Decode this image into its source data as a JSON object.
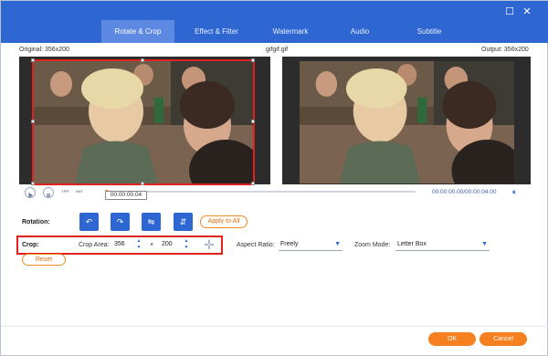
{
  "tabs": [
    {
      "label": "Rotate & Crop",
      "active": true
    },
    {
      "label": "Effect & Filter",
      "active": false
    },
    {
      "label": "Watermark",
      "active": false
    },
    {
      "label": "Audio",
      "active": false
    },
    {
      "label": "Subtitle",
      "active": false
    }
  ],
  "window_controls": {
    "maximize_icon": "maximize-icon",
    "close_icon": "close-icon"
  },
  "header": {
    "original_label": "Original: 356x200",
    "file_name": "gifgif.gif",
    "output_label": "Output: 356x200"
  },
  "playback": {
    "current_time": "00:00:00.04",
    "time_display": "00:00:00.00/00:00:04.00",
    "progress": 0.01
  },
  "rotation": {
    "label": "Rotation:",
    "buttons": [
      {
        "icon": "rotate-left-icon",
        "glyph": "↶"
      },
      {
        "icon": "rotate-right-icon",
        "glyph": "↷"
      },
      {
        "icon": "flip-horizontal-icon",
        "glyph": "⇋"
      },
      {
        "icon": "flip-vertical-icon",
        "glyph": "⇵"
      }
    ],
    "apply_all": "Apply to All"
  },
  "crop": {
    "label": "Crop:",
    "area_label": "Crop Area:",
    "width": "356",
    "height": "200",
    "times": "×",
    "aspect_ratio_label": "Aspect Ratio:",
    "aspect_ratio_value": "Freely",
    "zoom_mode_label": "Zoom Mode:",
    "zoom_mode_value": "Letter Box",
    "reset": "Reset"
  },
  "footer": {
    "ok": "OK",
    "cancel": "Cancel"
  },
  "colors": {
    "accent_blue": "#2f67d2",
    "accent_orange": "#f4801f",
    "highlight_red": "#e0221f"
  }
}
